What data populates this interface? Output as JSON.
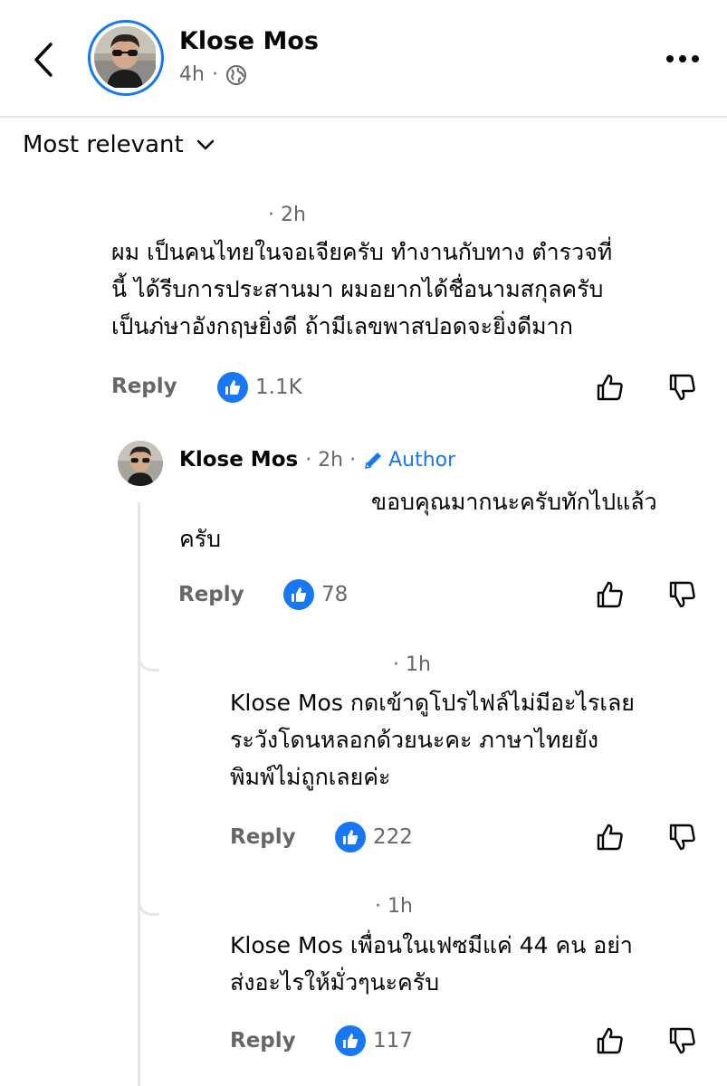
{
  "header": {
    "author_name": "Klose Mos",
    "time": "4h",
    "separator": "·"
  },
  "sort": {
    "label": "Most relevant"
  },
  "comments": [
    {
      "time": "· 2h",
      "lines": [
        "ผม เป็นคนไทยในจอเจียครับ ทำงานกับทาง ตำรวจที่",
        "นี้ ได้รีบการประสานมา ผมอยากได้ชื่อนามสกุลครับ",
        "เป็นภ่ษาอังกฤษยิ่งดี ถ้ามีเลขพาสปอดจะยิ่งดีมาก"
      ],
      "reply_label": "Reply",
      "likes": "1.1K"
    },
    {
      "author": "Klose Mos",
      "time": "· 2h ·",
      "badge": "Author",
      "lines": [
        "ขอบคุณมากนะครับทักไปแล้ว",
        "ครับ"
      ],
      "reply_label": "Reply",
      "likes": "78"
    },
    {
      "time": "· 1h",
      "lines": [
        "Klose Mos กดเข้าดูโปรไฟล์ไม่มีอะไรเลย",
        "ระวังโดนหลอกด้วยนะคะ ภาษาไทยยัง",
        "พิมพ์ไม่ถูกเลยค่ะ"
      ],
      "reply_label": "Reply",
      "likes": "222"
    },
    {
      "time": "· 1h",
      "lines": [
        "Klose Mos เพื่อนในเฟซมีแค่ 44 คน อย่า",
        "ส่งอะไรให้มั่วๆนะครับ"
      ],
      "reply_label": "Reply",
      "likes": "117"
    }
  ],
  "colors": {
    "accent": "#1877f2",
    "muted": "#65676b",
    "text": "#050505",
    "divider": "#e4e6eb"
  }
}
